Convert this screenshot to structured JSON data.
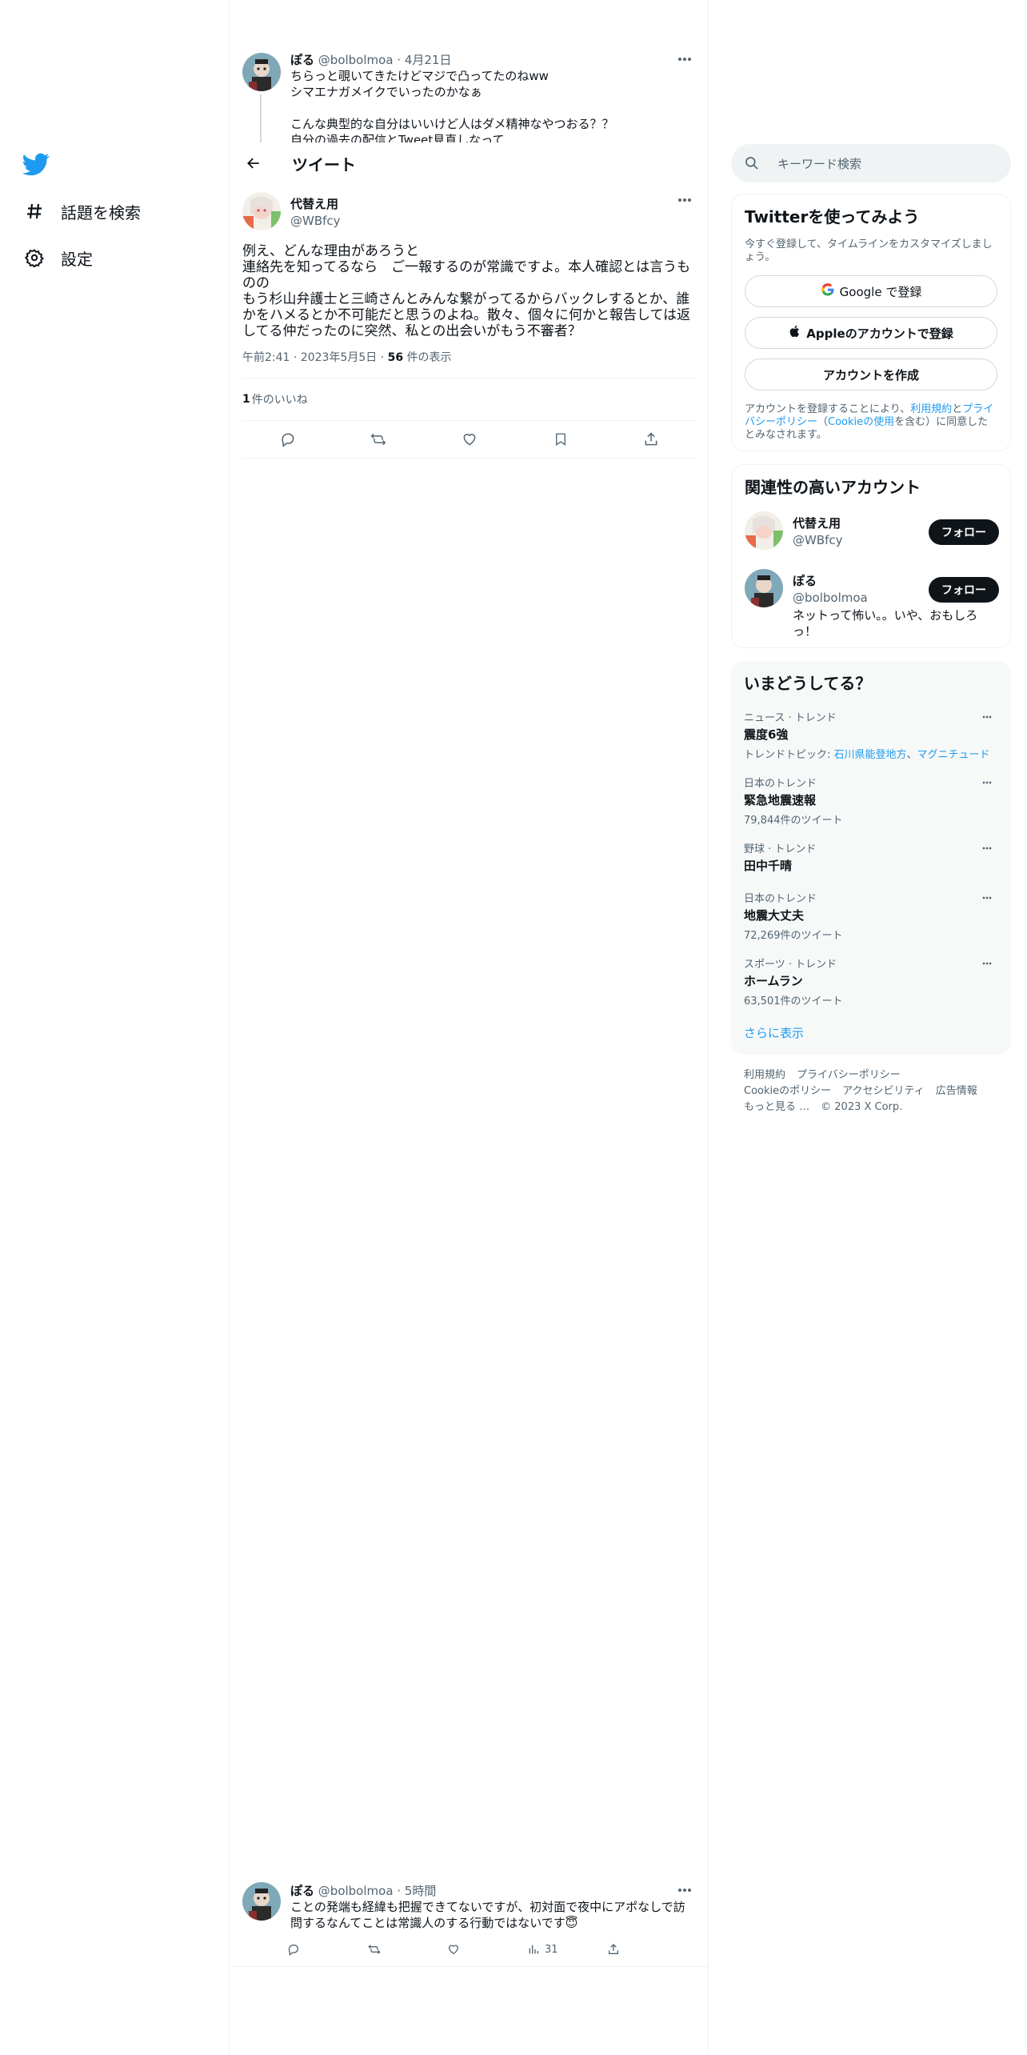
{
  "nav": {
    "explore_label": "話題を検索",
    "settings_label": "設定"
  },
  "header": {
    "title": "ツイート"
  },
  "top_tweet": {
    "name": "ぽる",
    "handle": "@bolbolmoa",
    "date": "· 4月21日",
    "text": "ちらっと覗いてきたけどマジで凸ってたのねww\nシマエナガメイクでいったのかなぁ\n\nこんな典型的な自分はいいけど人はダメ精神なやつおる？？\n自分の過去の配信とTweet見直しなって"
  },
  "focused_tweet": {
    "name": "代替え用",
    "handle": "@WBfcy",
    "text": "例え、どんな理由があろうと\n連絡先を知ってるなら　ご一報するのが常識ですよ。本人確認とは言うものの\nもう杉山弁護士と三崎さんとみんな繋がってるからバックレするとか、誰かをハメるとか不可能だと思うのよね。散々、個々に何かと報告しては返してる仲だったのに突然、私との出会いがもう不審者？",
    "time": "午前2:41",
    "date": "2023年5月5日",
    "views_num": "56",
    "views_label": "件の表示",
    "likes_num": "1",
    "likes_label": "件のいいね"
  },
  "reply_tweet": {
    "name": "ぽる",
    "handle": "@bolbolmoa",
    "time": "· 5時間",
    "text": "ことの発端も経緯も把握できてないですが、初対面で夜中にアポなしで訪問するなんてことは常識人のする行動ではないです😇",
    "views": "31"
  },
  "search": {
    "placeholder": "キーワード検索"
  },
  "signup": {
    "title": "Twitterを使ってみよう",
    "subtitle": "今すぐ登録して、タイムラインをカスタマイズしましょう。",
    "google_label": "Google で登録",
    "apple_label": "Appleのアカウントで登録",
    "create_label": "アカウントを作成",
    "legal_prefix": "アカウントを登録することにより、",
    "legal_terms": "利用規約",
    "legal_and": "と",
    "legal_privacy": "プライバシーポリシー",
    "legal_mid": "（",
    "legal_cookie": "Cookieの使用",
    "legal_suffix": "を含む）に同意したとみなされます。"
  },
  "related": {
    "title": "関連性の高いアカウント",
    "accounts": [
      {
        "name": "代替え用",
        "handle": "@WBfcy",
        "bio": "",
        "follow": "フォロー"
      },
      {
        "name": "ぽる",
        "handle": "@bolbolmoa",
        "bio": "ネットって怖い。。いや、おもしろっ！",
        "follow": "フォロー"
      }
    ]
  },
  "trends": {
    "title": "いまどうしてる？",
    "items": [
      {
        "context": "ニュース · トレンド",
        "name": "震度6強",
        "topics_label": "トレンドトピック: ",
        "topic1": "石川県能登地方",
        "topic2": "マグニチュード"
      },
      {
        "context": "日本のトレンド",
        "name": "緊急地震速報",
        "count": "79,844件のツイート"
      },
      {
        "context": "野球 · トレンド",
        "name": "田中千晴",
        "count": ""
      },
      {
        "context": "日本のトレンド",
        "name": "地震大丈夫",
        "count": "72,269件のツイート"
      },
      {
        "context": "スポーツ · トレンド",
        "name": "ホームラン",
        "count": "63,501件のツイート"
      }
    ],
    "show_more": "さらに表示"
  },
  "footer": {
    "terms": "利用規約",
    "privacy": "プライバシーポリシー",
    "cookie": "Cookieのポリシー",
    "accessibility": "アクセシビリティ",
    "ads": "広告情報",
    "more": "もっと見る …",
    "copyright": "© 2023 X Corp."
  },
  "colors": {
    "brand": "#1d9bf0",
    "text": "#0f1419",
    "muted": "#536471"
  }
}
